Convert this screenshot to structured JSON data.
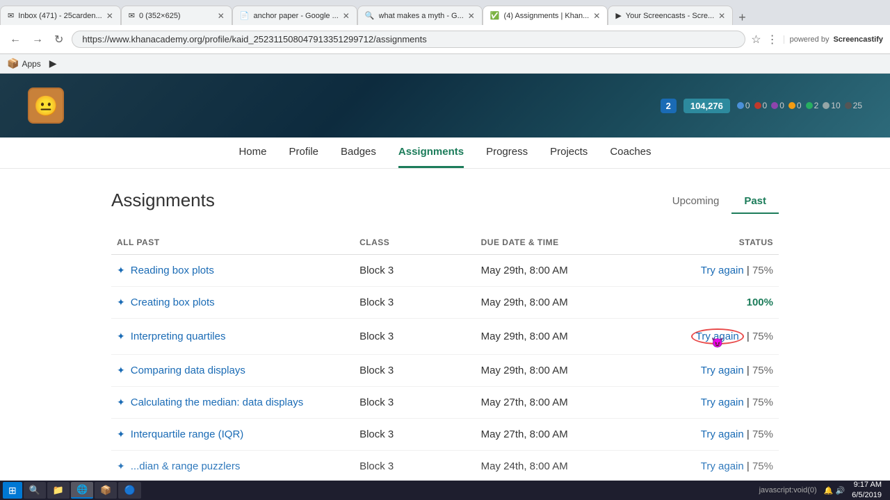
{
  "browser": {
    "tabs": [
      {
        "id": "tab1",
        "favicon": "✉",
        "title": "Inbox (471) - 25carden...",
        "active": false
      },
      {
        "id": "tab2",
        "favicon": "✉",
        "title": "0 (352×625)",
        "active": false
      },
      {
        "id": "tab3",
        "favicon": "📄",
        "title": "anchor paper - Google ...",
        "active": false
      },
      {
        "id": "tab4",
        "favicon": "🔍",
        "title": "what makes a myth - G...",
        "active": false
      },
      {
        "id": "tab5",
        "favicon": "✅",
        "title": "(4) Assignments | Khan...",
        "active": true
      },
      {
        "id": "tab6",
        "favicon": "▶",
        "title": "Your Screencasts - Scre...",
        "active": false
      }
    ],
    "address": "https://www.khanacademy.org/profile/kaid_252311508047913351299712/assignments",
    "bookmarks": [
      {
        "icon": "📦",
        "label": "Apps"
      },
      {
        "icon": "▶",
        "label": ""
      }
    ]
  },
  "header": {
    "avatar_emoji": "😐",
    "badge_value": "2",
    "points_value": "104,276",
    "gems": [
      {
        "color": "#4a90d9",
        "count": "0"
      },
      {
        "color": "#c0392b",
        "count": "0"
      },
      {
        "color": "#8e44ad",
        "count": "0"
      },
      {
        "color": "#f39c12",
        "count": "0"
      },
      {
        "color": "#27ae60",
        "count": "2"
      },
      {
        "color": "#95a5a6",
        "count": "10"
      },
      {
        "color": "#555",
        "count": "25"
      }
    ]
  },
  "nav": {
    "items": [
      {
        "label": "Home",
        "active": false
      },
      {
        "label": "Profile",
        "active": false
      },
      {
        "label": "Badges",
        "active": false
      },
      {
        "label": "Assignments",
        "active": true
      },
      {
        "label": "Progress",
        "active": false
      },
      {
        "label": "Projects",
        "active": false
      },
      {
        "label": "Coaches",
        "active": false
      }
    ]
  },
  "page": {
    "title": "Assignments",
    "tabs": [
      {
        "label": "Upcoming",
        "active": false
      },
      {
        "label": "Past",
        "active": true
      }
    ],
    "table": {
      "headers": [
        "ALL PAST",
        "CLASS",
        "DUE DATE & TIME",
        "STATUS"
      ],
      "rows": [
        {
          "icon": "✦",
          "name": "Reading box plots",
          "class": "Block 3",
          "due": "May 29th, 8:00 AM",
          "status": "Try again",
          "pct": "75%",
          "highlighted": false,
          "pct_style": "normal",
          "separator": " | "
        },
        {
          "icon": "✦",
          "name": "Creating box plots",
          "class": "Block 3",
          "due": "May 29th, 8:00 AM",
          "status": "",
          "pct": "100%",
          "highlighted": false,
          "pct_style": "hundred",
          "separator": ""
        },
        {
          "icon": "✦",
          "name": "Interpreting quartiles",
          "class": "Block 3",
          "due": "May 29th, 8:00 AM",
          "status": "Try again",
          "pct": "75%",
          "highlighted": true,
          "pct_style": "normal",
          "separator": " | "
        },
        {
          "icon": "✦",
          "name": "Comparing data displays",
          "class": "Block 3",
          "due": "May 29th, 8:00 AM",
          "status": "Try again",
          "pct": "75%",
          "highlighted": false,
          "pct_style": "normal",
          "separator": " | "
        },
        {
          "icon": "✦",
          "name": "Calculating the median: data displays",
          "class": "Block 3",
          "due": "May 27th, 8:00 AM",
          "status": "Try again",
          "pct": "75%",
          "highlighted": false,
          "pct_style": "normal",
          "separator": " | "
        },
        {
          "icon": "✦",
          "name": "Interquartile range (IQR)",
          "class": "Block 3",
          "due": "May 27th, 8:00 AM",
          "status": "Try again",
          "pct": "75%",
          "highlighted": false,
          "pct_style": "normal",
          "separator": " | "
        },
        {
          "icon": "✦",
          "name": "...dian & range puzzlers",
          "class": "Block 3",
          "due": "May 24th, 8:00 AM",
          "status": "Try again",
          "pct": "75%",
          "highlighted": false,
          "pct_style": "normal",
          "separator": " | "
        }
      ]
    }
  },
  "taskbar": {
    "start_icon": "⊞",
    "buttons": [
      {
        "label": "⊞",
        "active": false
      },
      {
        "label": "📁",
        "active": false
      },
      {
        "label": "🌐",
        "active": false
      },
      {
        "label": "📦",
        "active": false
      },
      {
        "label": "🔵",
        "active": true
      }
    ],
    "status_text": "javascript:void(0)",
    "time": "9:17 AM",
    "date": "6/5/2019"
  }
}
